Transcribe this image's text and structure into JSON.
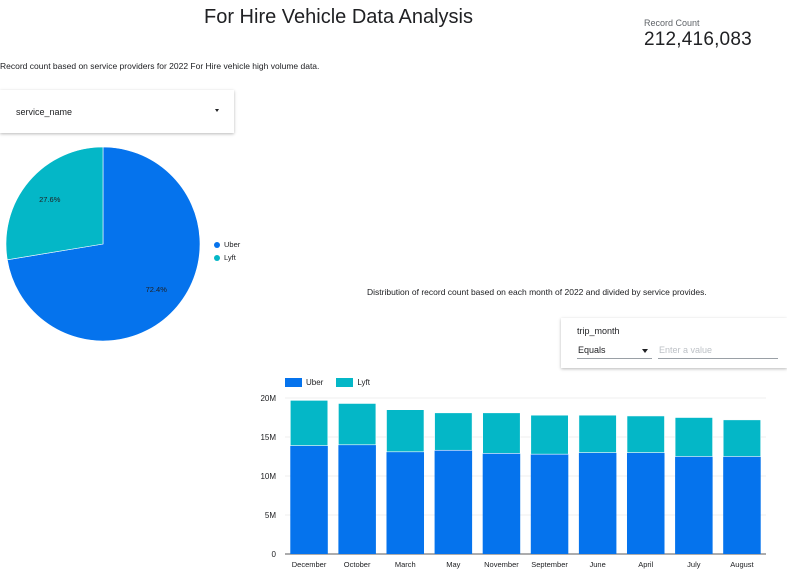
{
  "header": {
    "title": "For Hire Vehicle Data Analysis",
    "kpi_label": "Record Count",
    "kpi_value": "212,416,083"
  },
  "pie_section": {
    "description": "Record count based on service providers for 2022 For Hire vehicle high volume data.",
    "filter_label": "service_name"
  },
  "bar_section": {
    "description": "Distribution of record count based on each month of 2022 and divided by service provides.",
    "filter": {
      "label": "trip_month",
      "operator": "Equals",
      "placeholder": "Enter a value"
    }
  },
  "colors": {
    "uber": "#0573ed",
    "lyft": "#04b7c7",
    "grid": "#e0e0e0",
    "axis": "#202124"
  },
  "chart_data": [
    {
      "type": "pie",
      "series": [
        {
          "name": "Uber",
          "value": 72.4,
          "label": "72.4%"
        },
        {
          "name": "Lyft",
          "value": 27.6,
          "label": "27.6%"
        }
      ],
      "legend": "right"
    },
    {
      "type": "bar",
      "stacked": true,
      "categories": [
        "December",
        "October",
        "March",
        "May",
        "November",
        "September",
        "June",
        "April",
        "July",
        "August"
      ],
      "series": [
        {
          "name": "Uber",
          "values": [
            13.9,
            14.0,
            13.1,
            13.3,
            12.9,
            12.8,
            13.0,
            13.0,
            12.5,
            12.5
          ]
        },
        {
          "name": "Lyft",
          "values": [
            5.8,
            5.3,
            5.4,
            4.8,
            5.2,
            5.0,
            4.8,
            4.7,
            5.0,
            4.7
          ]
        }
      ],
      "ylim": [
        0,
        20
      ],
      "yticks": [
        {
          "value": 0,
          "label": "0"
        },
        {
          "value": 5,
          "label": "5M"
        },
        {
          "value": 10,
          "label": "10M"
        },
        {
          "value": 15,
          "label": "15M"
        },
        {
          "value": 20,
          "label": "20M"
        }
      ],
      "grid": true,
      "legend": "top-left"
    }
  ]
}
